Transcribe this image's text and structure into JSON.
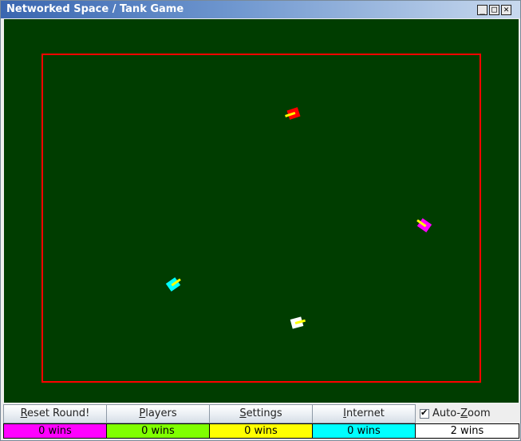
{
  "window": {
    "title": "Networked Space / Tank Game",
    "controls": {
      "minimize": "_",
      "maximize": "□",
      "close": "✕"
    }
  },
  "arena": {
    "background": "#003d00",
    "boundary_color": "#ff0000",
    "tanks": [
      {
        "name": "red-tank",
        "color": "#ff0000",
        "turret_color": "#ffff00"
      },
      {
        "name": "magenta-tank",
        "color": "#ff00ff",
        "turret_color": "#ffff00"
      },
      {
        "name": "cyan-tank",
        "color": "#00ffff",
        "turret_color": "#ffff00"
      },
      {
        "name": "white-tank",
        "color": "#ffffff",
        "turret_color": "#ffff00"
      }
    ]
  },
  "buttons": {
    "reset_round": {
      "mnemonic": "R",
      "rest": "eset Round!"
    },
    "players": {
      "mnemonic": "P",
      "rest": "layers"
    },
    "settings": {
      "mnemonic": "S",
      "rest": "ettings"
    },
    "internet": {
      "mnemonic": "I",
      "rest": "nternet"
    },
    "auto_zoom": {
      "before": "Auto-",
      "mnemonic": "Z",
      "after": "oom",
      "checked": true,
      "check_glyph": "✔"
    }
  },
  "scores": [
    {
      "name": "magenta",
      "color": "#ff00ff",
      "text": "0 wins"
    },
    {
      "name": "green",
      "color": "#80ff00",
      "text": "0 wins"
    },
    {
      "name": "yellow",
      "color": "#ffff00",
      "text": "0 wins"
    },
    {
      "name": "cyan",
      "color": "#00ffff",
      "text": "0 wins"
    },
    {
      "name": "white",
      "color": "#ffffff",
      "text": "2 wins"
    }
  ]
}
